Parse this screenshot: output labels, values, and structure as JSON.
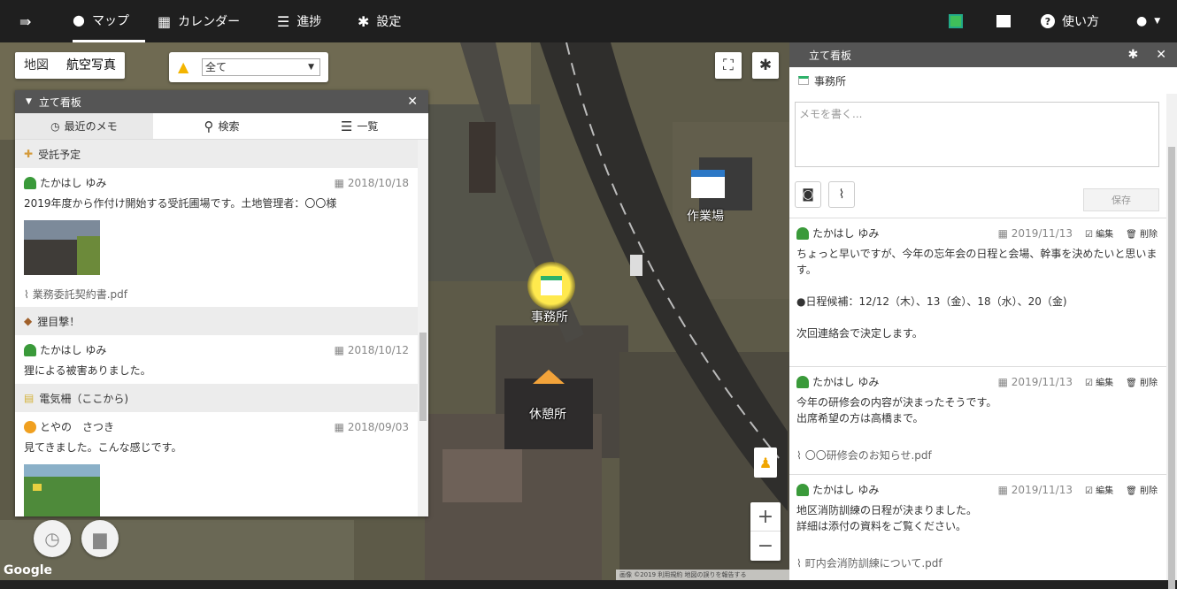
{
  "nav": {
    "items": [
      {
        "icon": "menu-toggle-icon",
        "label": ""
      },
      {
        "icon": "map-pin-icon",
        "label": "マップ"
      },
      {
        "icon": "calendar-icon",
        "label": "カレンダー"
      },
      {
        "icon": "list-icon",
        "label": "進捗"
      },
      {
        "icon": "gear-icon",
        "label": "設定"
      }
    ],
    "right": {
      "help_label": "使い方"
    }
  },
  "map": {
    "types": [
      "地図",
      "航空写真"
    ],
    "selected_type": "航空写真",
    "filter_value": "全て",
    "markers": [
      "事務所",
      "休憩所",
      "作業場"
    ],
    "google": "Google",
    "attribution": "画像 ©2019  利用規約  地図の誤りを報告する"
  },
  "panel": {
    "title": "立て看板",
    "tabs": [
      {
        "icon": "clock-icon",
        "label": "最近のメモ"
      },
      {
        "icon": "search-icon",
        "label": "検索"
      },
      {
        "icon": "list-icon",
        "label": "一覧"
      }
    ],
    "groups": [
      {
        "category": "受託予定",
        "memos": [
          {
            "author": "たかはし ゆみ",
            "date": "2018/10/18",
            "body": "2019年度から作付け開始する受託圃場です。土地管理者：〇〇様",
            "attachment": "業務委託契約書.pdf",
            "has_photo": true
          }
        ]
      },
      {
        "category": "狸目撃！",
        "memos": [
          {
            "author": "たかはし ゆみ",
            "date": "2018/10/12",
            "body": "狸による被害ありました。"
          }
        ]
      },
      {
        "category": "電気柵（ここから)",
        "memos": [
          {
            "author": "とやの　さつき",
            "date": "2018/09/03",
            "body": "見てきました。こんな感じです。",
            "has_photo": true
          }
        ]
      }
    ]
  },
  "side": {
    "header": "立て看板",
    "place": "事務所",
    "memo_placeholder": "メモを書く...",
    "save_label": "保存",
    "edit_label": "編集",
    "delete_label": "削除",
    "memos": [
      {
        "author": "たかはし ゆみ",
        "date": "2019/11/13",
        "lines": [
          "ちょっと早いですが、今年の忘年会の日程と会場、幹事を決めたいと思います。",
          "",
          "●日程候補：12/12（木）、13（金）、18（水）、20（金)",
          "",
          "次回連絡会で決定します。"
        ]
      },
      {
        "author": "たかはし ゆみ",
        "date": "2019/11/13",
        "lines": [
          "今年の研修会の内容が決まったそうです。",
          "出席希望の方は高橋まで。"
        ],
        "attachment": "〇〇研修会のお知らせ.pdf"
      },
      {
        "author": "たかはし ゆみ",
        "date": "2019/11/13",
        "lines": [
          "地区消防訓練の日程が決まりました。",
          "詳細は添付の資料をご覧ください。"
        ],
        "attachment": "町内会消防訓練について.pdf"
      }
    ]
  }
}
